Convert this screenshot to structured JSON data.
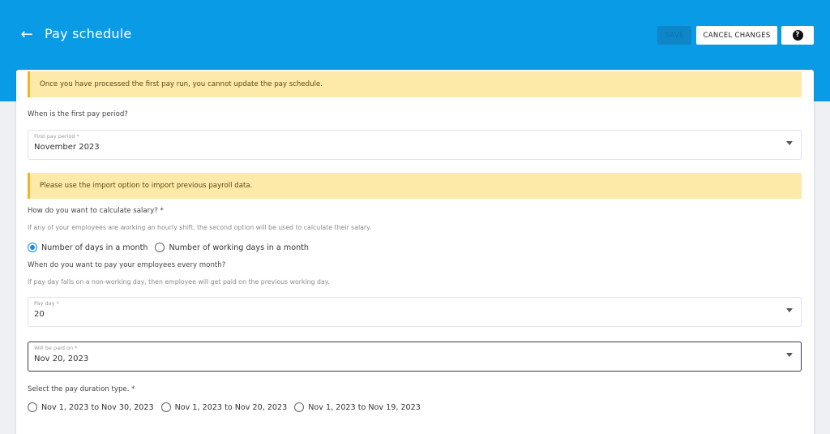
{
  "header": {
    "title": "Pay schedule",
    "save_label": "SAVE",
    "cancel_label": "CANCEL CHANGES",
    "help_glyph": "?"
  },
  "alerts": {
    "pay_run": "Once you have processed the first pay run, you cannot update the pay schedule.",
    "import": "Please use the import option to import previous payroll data."
  },
  "first_period": {
    "question": "When is the first pay period?",
    "field_label": "First pay period *",
    "value": "November 2023"
  },
  "salary_calc": {
    "question": "How do you want to calculate salary? *",
    "hint": "If any of your employees are working an hourly shift, the second option will be used to calculate their salary.",
    "options": [
      "Number of days in a month",
      "Number of working days in a month"
    ],
    "selected_index": 0
  },
  "pay_day": {
    "question": "When do you want to pay your employees every month?",
    "hint": "If pay day falls on a non-working day, then employee will get paid on the previous working day.",
    "field_label": "Pay day *",
    "value": "20"
  },
  "paid_on": {
    "field_label": "Will be paid on *",
    "value": "Nov 20, 2023"
  },
  "duration": {
    "question": "Select the pay duration type. *",
    "options": [
      "Nov 1, 2023 to Nov 30, 2023",
      "Nov 1, 2023 to Nov 20, 2023",
      "Nov 1, 2023 to Nov 19, 2023"
    ]
  },
  "colors": {
    "header_bg": "#0a9be6",
    "alert_bg": "#fde9a8",
    "radio_accent": "#1a8bd8"
  }
}
